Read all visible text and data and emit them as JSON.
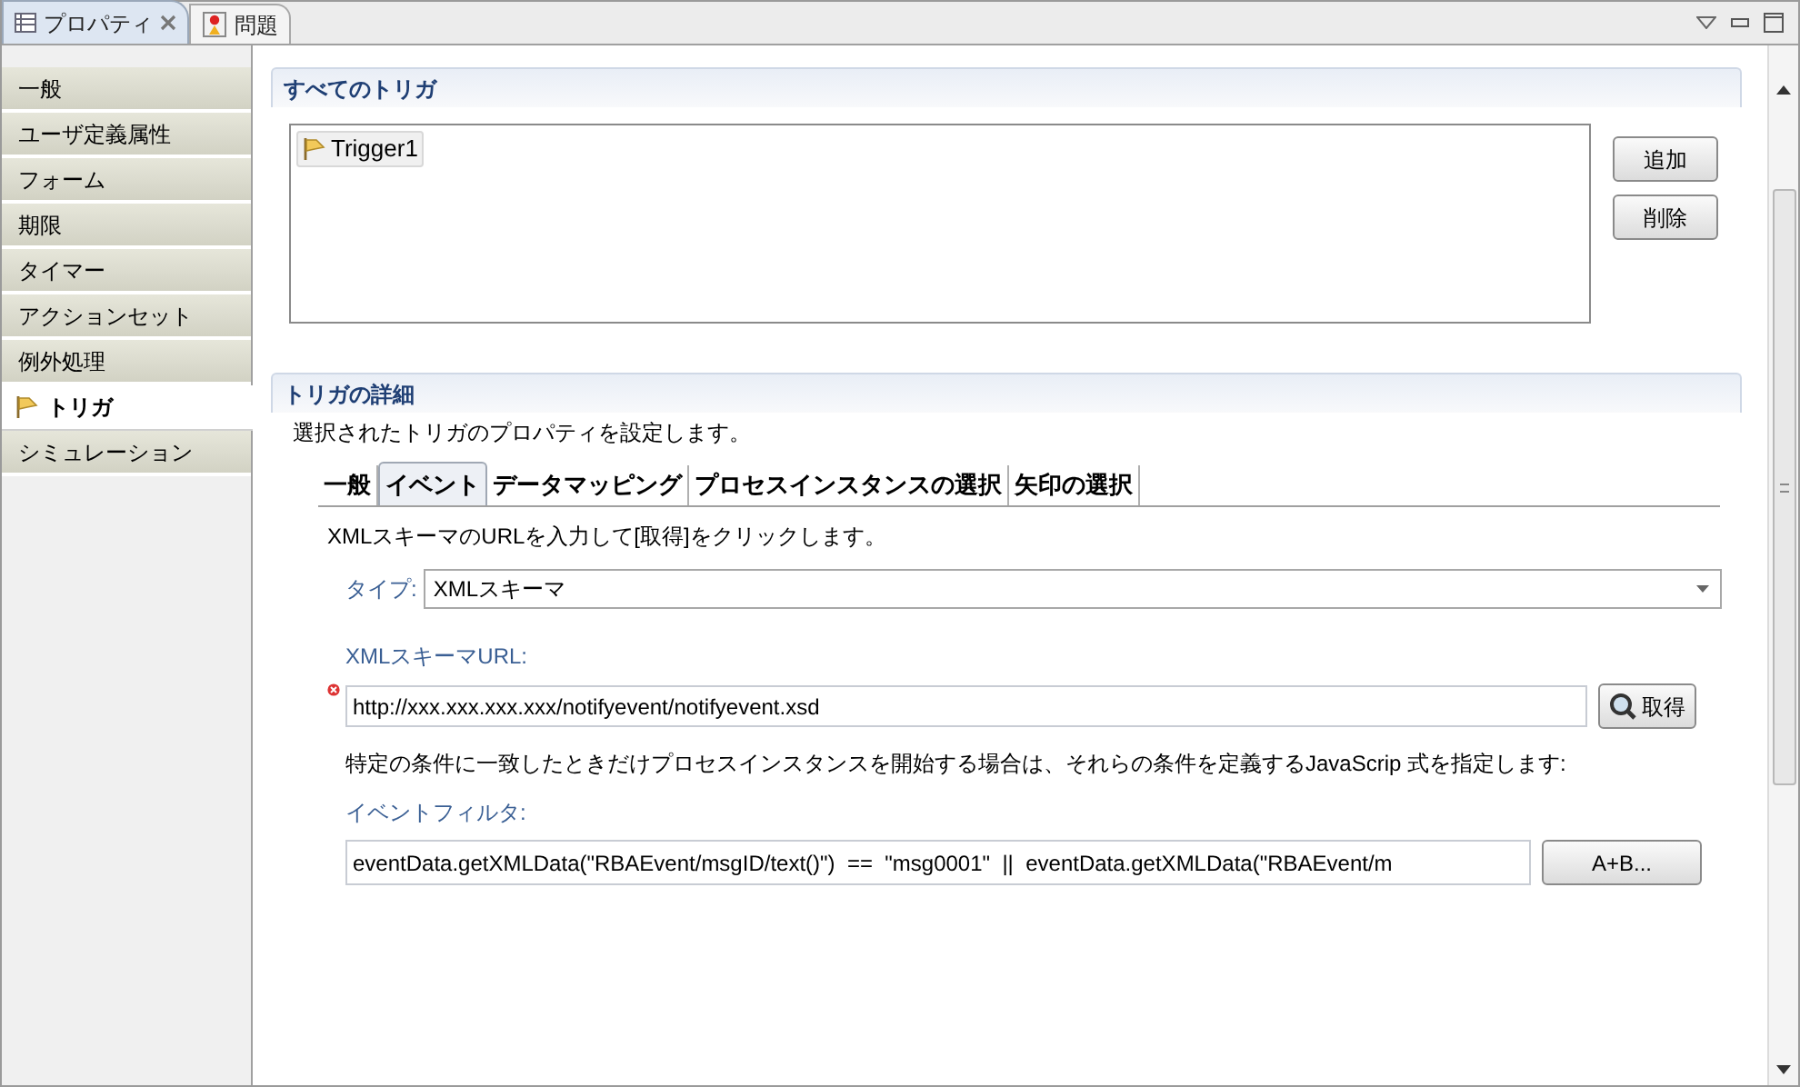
{
  "view_tabs": [
    {
      "label": "プロパティ",
      "selected": true,
      "closable": true,
      "kind": "properties"
    },
    {
      "label": "問題",
      "selected": false,
      "closable": false,
      "kind": "problems"
    }
  ],
  "sidebar": {
    "items": [
      {
        "label": "一般",
        "selected": false
      },
      {
        "label": "ユーザ定義属性",
        "selected": false
      },
      {
        "label": "フォーム",
        "selected": false
      },
      {
        "label": "期限",
        "selected": false
      },
      {
        "label": "タイマー",
        "selected": false
      },
      {
        "label": "アクションセット",
        "selected": false
      },
      {
        "label": "例外処理",
        "selected": false
      },
      {
        "label": "トリガ",
        "selected": true
      },
      {
        "label": "シミュレーション",
        "selected": false
      }
    ]
  },
  "all_triggers": {
    "title": "すべてのトリガ",
    "items": [
      {
        "label": "Trigger1"
      }
    ],
    "buttons": [
      "追加",
      "削除"
    ]
  },
  "details": {
    "title": "トリガの詳細",
    "description": "選択されたトリガのプロパティを設定します。",
    "tabs": [
      {
        "label": "一般",
        "selected": false
      },
      {
        "label": "イベント",
        "selected": true
      },
      {
        "label": "データマッピング",
        "selected": false
      },
      {
        "label": "プロセスインスタンスの選択",
        "selected": false
      },
      {
        "label": "矢印の選択",
        "selected": false
      }
    ],
    "instruction": "XMLスキーマのURLを入力して[取得]をクリックします。",
    "type_label": "タイプ:",
    "type_value": "XMLスキーマ",
    "url_label": "XMLスキーマURL:",
    "url_value": "http://xxx.xxx.xxx.xxx/notifyevent/notifyevent.xsd",
    "url_error": true,
    "fetch_button": "取得",
    "filter_hint": "特定の条件に一致したときだけプロセスインスタンスを開始する場合は、それらの条件を定義するJavaScrip 式を指定します:",
    "filter_label": "イベントフィルタ:",
    "filter_value": "eventData.getXMLData(\"RBAEvent/msgID/text()\")  ==  \"msg0001\"  ||  eventData.getXMLData(\"RBAEvent/m",
    "expression_button": "A+B..."
  }
}
